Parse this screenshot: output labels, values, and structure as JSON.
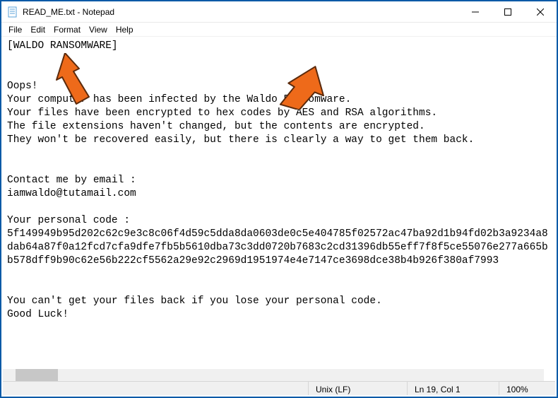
{
  "window": {
    "title": "READ_ME.txt - Notepad"
  },
  "menu": {
    "file": "File",
    "edit": "Edit",
    "format": "Format",
    "view": "View",
    "help": "Help"
  },
  "content": {
    "text": "[WALDO RANSOMWARE]\n\n\nOops!\nYour computer has been infected by the Waldo Ransomware.\nYour files have been encrypted to hex codes by AES and RSA algorithms.\nThe file extensions haven't changed, but the contents are encrypted.\nThey won't be recovered easily, but there is clearly a way to get them back.\n\n\nContact me by email :\niamwaldo@tutamail.com\n\nYour personal code :\n5f149949b95d202c62c9e3c8c06f4d59c5dda8da0603de0c5e404785f02572ac47ba92d1b94fd02b3a9234a8dab64a87f0a12fcd7cfa9dfe7fb5b5610dba73c3dd0720b7683c2cd31396db55eff7f8f5ce55076e277a665bb578dff9b90c62e56b222cf5562a29e92c2969d1951974e4e7147ce3698dce38b4b926f380af7993\n\n\nYou can't get your files back if you lose your personal code.\nGood Luck!"
  },
  "status": {
    "line_ending": "Unix (LF)",
    "cursor": "Ln 19, Col 1",
    "zoom": "100%"
  },
  "annotations": {
    "arrow1_target": "WALDO RANSOMWARE header",
    "arrow2_target": "Waldo Ransomware name in body"
  }
}
